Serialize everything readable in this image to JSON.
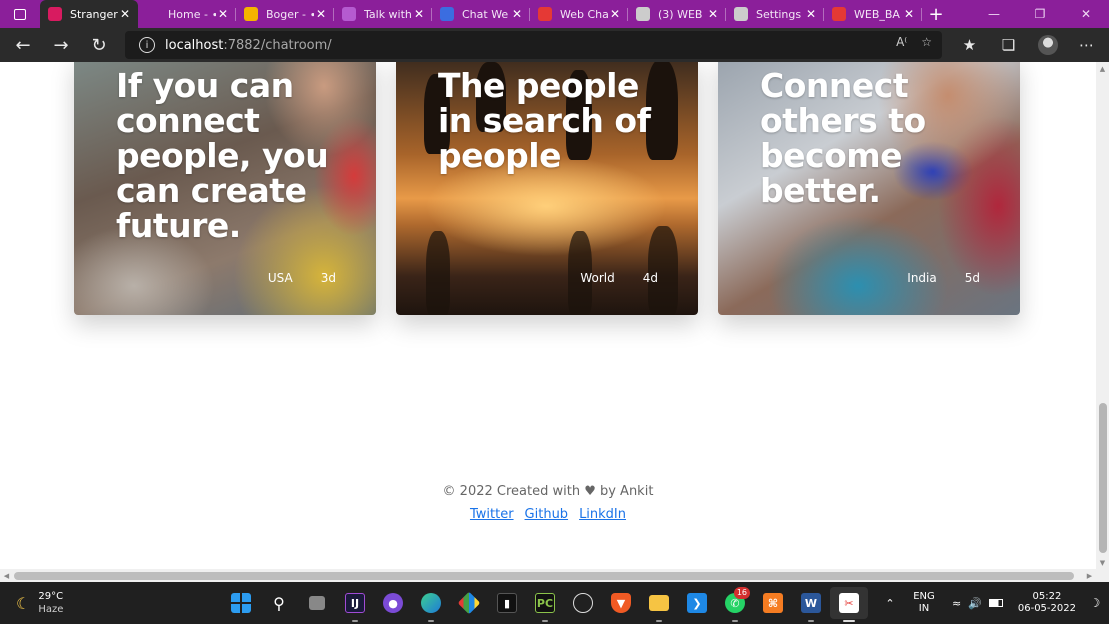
{
  "browser": {
    "tabs": [
      {
        "label": "Stranger",
        "favicon_color": "#d81b60",
        "active": true
      },
      {
        "label": "Home - ∙",
        "favicon_color": "#8b1f9a"
      },
      {
        "label": "Boger - ∙",
        "favicon_color": "#f5b400"
      },
      {
        "label": "Talk with",
        "favicon_color": "#b55bd0"
      },
      {
        "label": "Chat We",
        "favicon_color": "#3b6de0"
      },
      {
        "label": "Web Cha",
        "favicon_color": "#e53935"
      },
      {
        "label": "(3) WEB",
        "favicon_color": "#cccccc"
      },
      {
        "label": "Settings",
        "favicon_color": "#cccccc"
      },
      {
        "label": "WEB_BA",
        "favicon_color": "#e53935"
      }
    ],
    "address": {
      "host": "localhost",
      "path": ":7882/chatroom/"
    }
  },
  "page": {
    "cards": [
      {
        "quote": "If you can connect people, you can create future.",
        "location": "USA",
        "age": "3d"
      },
      {
        "quote": "The people in search of people",
        "location": "World",
        "age": "4d"
      },
      {
        "quote": "Connect others to become better.",
        "location": "India",
        "age": "5d"
      }
    ],
    "footer": {
      "copyright": "© 2022 Created with ♥ by Ankit",
      "links": [
        "Twitter",
        "Github",
        "LinkdIn"
      ]
    }
  },
  "taskbar": {
    "weather": {
      "temp": "29°C",
      "condition": "Haze"
    },
    "lang": {
      "line1": "ENG",
      "line2": "IN"
    },
    "clock": {
      "time": "05:22",
      "date": "06-05-2022"
    },
    "whatsapp_badge": "16",
    "colors": {
      "accent": "#8b1f9a",
      "link": "#1a73e8",
      "taskbar": "#202020"
    }
  }
}
